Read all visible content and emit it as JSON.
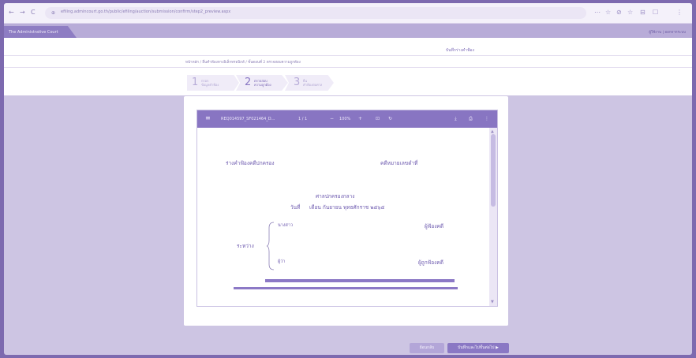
{
  "browser": {
    "back": "←",
    "forward": "→",
    "reload": "C",
    "lock": "⊕",
    "url": "efiling.admincourt.go.th/public/efiling/auction/submission/confirm/step2_preview.aspx",
    "tools": [
      "⋯",
      "☆",
      "⊘",
      "☆",
      "⊟",
      "☐",
      "⋮"
    ]
  },
  "app": {
    "title": "The Administrative Court",
    "header_right": "ผู้ใช้งาน | ออกจากระบบ"
  },
  "content": {
    "save_link": "บันทึกร่างคำฟ้อง",
    "breadcrumb": "หน้าหลัก / ยื่นคำฟ้องทางอิเล็กทรอนิกส์ / ขั้นตอนที่ 2 ตรวจสอบความถูกต้อง"
  },
  "stepper": [
    {
      "num": "1",
      "label1": "กรอก",
      "label2": "ข้อมูลคำฟ้อง"
    },
    {
      "num": "2",
      "label1": "ตรวจสอบ",
      "label2": "ความถูกต้อง"
    },
    {
      "num": "3",
      "label1": "ยื่น",
      "label2": "คำฟ้องต่อศาล"
    }
  ],
  "viewer": {
    "menu": "≡",
    "filename": "REQ014597_SF021464_D...",
    "page": "1 / 1",
    "zoom_out": "−",
    "zoom": "100%",
    "zoom_in": "+",
    "fit": "⊡",
    "rotate": "↻",
    "download": "⤓",
    "print": "⎙",
    "more": "⋮",
    "scroll_up": "▲",
    "scroll_down": "▼"
  },
  "document": {
    "form_title": "ร่างคำฟ้องคดีปกครอง",
    "case_number": "คดีหมายเลขดำที่",
    "court": "ศาลปกครองกลาง",
    "date_label": "วันที่",
    "date_value": "เดือน กันยายน พุทธศักราช ๒๕๖๕",
    "plaintiff_name": "นางสาว",
    "plaintiff_role": "ผู้ฟ้องคดี",
    "between": "ระหว่าง",
    "defendant_name": "ผู้ว่า",
    "defendant_role": "ผู้ถูกฟ้องคดี"
  },
  "buttons": {
    "back": "ย้อนกลับ",
    "save_next": "บันทึกและไปขั้นต่อไป ▶"
  }
}
